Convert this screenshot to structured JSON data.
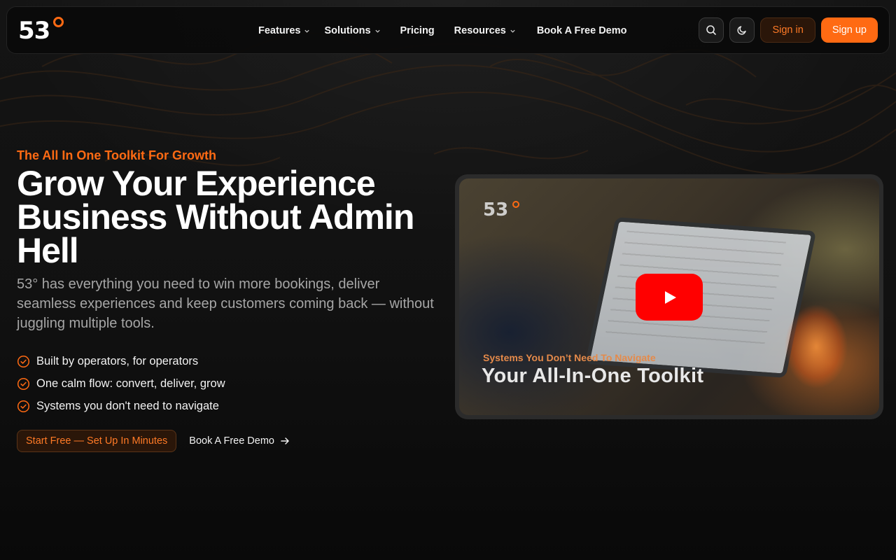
{
  "brand": {
    "logo_text": "53",
    "accent_color": "#ff6a13"
  },
  "nav": {
    "items": [
      {
        "label": "Features",
        "dropdown": true
      },
      {
        "label": "Solutions",
        "dropdown": true
      },
      {
        "label": "Pricing",
        "dropdown": false
      },
      {
        "label": "Resources",
        "dropdown": true
      },
      {
        "label": "Book A Free Demo",
        "dropdown": false
      }
    ],
    "search_icon": "search-icon",
    "theme_icon": "moon-icon",
    "signin_label": "Sign in",
    "signup_label": "Sign up"
  },
  "hero": {
    "eyebrow": "The All In One Toolkit For Growth",
    "headline": "Grow Your Experience Business Without Admin Hell",
    "subtext": "53° has everything you need to win more bookings, deliver seamless experiences and keep customers coming back — without juggling multiple tools.",
    "features": [
      "Built by operators, for operators",
      "One calm flow: convert, deliver, grow",
      "Systems you don't need to navigate"
    ],
    "primary_cta": "Start Free — Set Up In Minutes",
    "secondary_cta": "Book A Free Demo"
  },
  "video": {
    "logo_text": "53",
    "subtitle": "Systems You Don’t Need To Navigate",
    "title": "Your All-In-One Toolkit",
    "play_color": "#ff0000"
  }
}
